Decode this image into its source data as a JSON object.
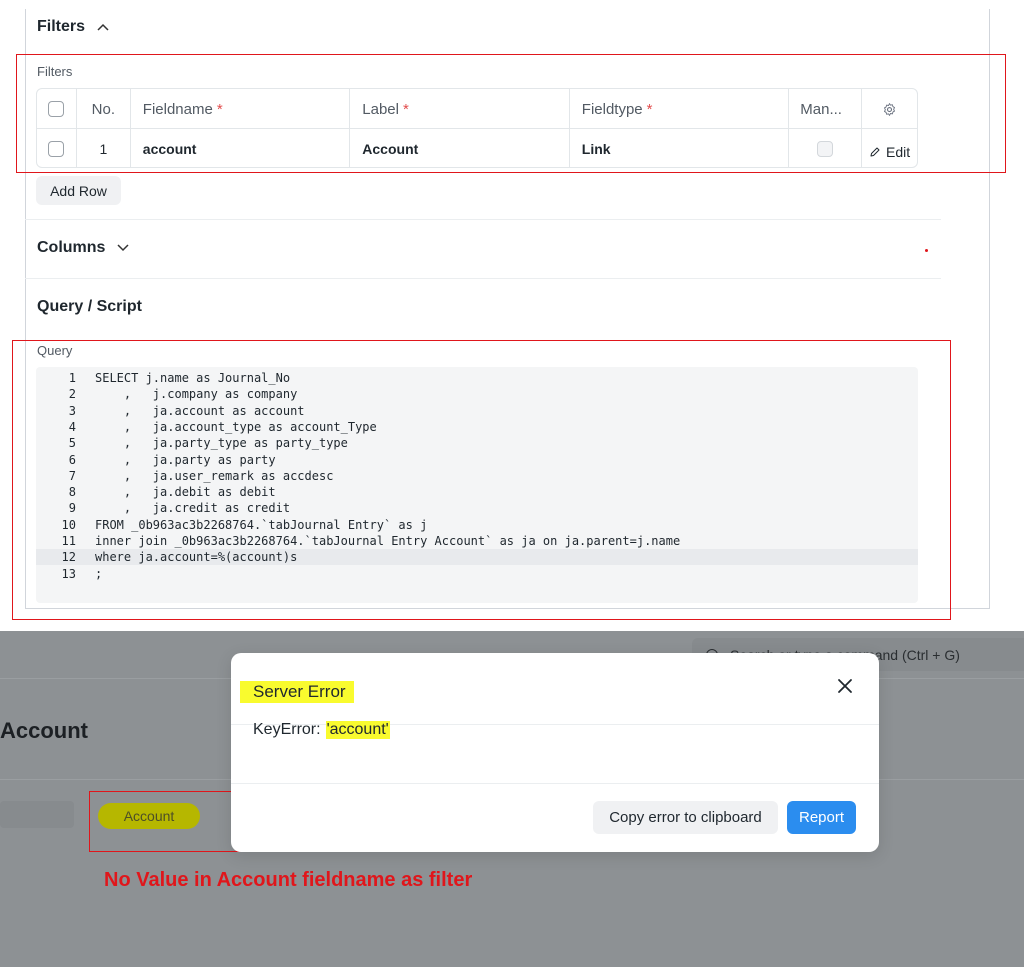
{
  "filters_section": {
    "title": "Filters",
    "inner_label": "Filters",
    "columns": {
      "no": "No.",
      "fieldname": "Fieldname",
      "label": "Label",
      "fieldtype": "Fieldtype",
      "mandatory": "Man..."
    },
    "required_mark": "*",
    "rows": [
      {
        "no": "1",
        "fieldname": "account",
        "label": "Account",
        "fieldtype": "Link"
      }
    ],
    "edit_label": "Edit",
    "add_row_label": "Add Row"
  },
  "columns_section": {
    "title": "Columns"
  },
  "query_section": {
    "title": "Query / Script",
    "query_label": "Query",
    "lines": [
      {
        "n": "1",
        "text": "SELECT j.name as Journal_No"
      },
      {
        "n": "2",
        "text": "    ,   j.company as company"
      },
      {
        "n": "3",
        "text": "    ,   ja.account as account"
      },
      {
        "n": "4",
        "text": "    ,   ja.account_type as account_Type"
      },
      {
        "n": "5",
        "text": "    ,   ja.party_type as party_type"
      },
      {
        "n": "6",
        "text": "    ,   ja.party as party"
      },
      {
        "n": "7",
        "text": "    ,   ja.user_remark as accdesc"
      },
      {
        "n": "8",
        "text": "    ,   ja.debit as debit"
      },
      {
        "n": "9",
        "text": "    ,   ja.credit as credit"
      },
      {
        "n": "10",
        "text": "FROM _0b963ac3b2268764.`tabJournal Entry` as j"
      },
      {
        "n": "11",
        "text": "inner join _0b963ac3b2268764.`tabJournal Entry Account` as ja on ja.parent=j.name"
      },
      {
        "n": "12",
        "text": "where ja.account=%(account)s"
      },
      {
        "n": "13",
        "text": ";"
      }
    ]
  },
  "background": {
    "search_text": "Search or type a command (Ctrl + G)",
    "page_title": "Account",
    "filter_field_text": "Account"
  },
  "dialog": {
    "title": "Server Error",
    "message_prefix": "KeyError:",
    "message_key": "'account'",
    "copy_button": "Copy error to clipboard",
    "report_button": "Report"
  },
  "annotation": {
    "note": "No Value in Account fieldname as filter"
  },
  "colors": {
    "annotation_red": "#e0161b",
    "highlight_yellow": "#f9fb2e",
    "primary_blue": "#2b8def"
  }
}
